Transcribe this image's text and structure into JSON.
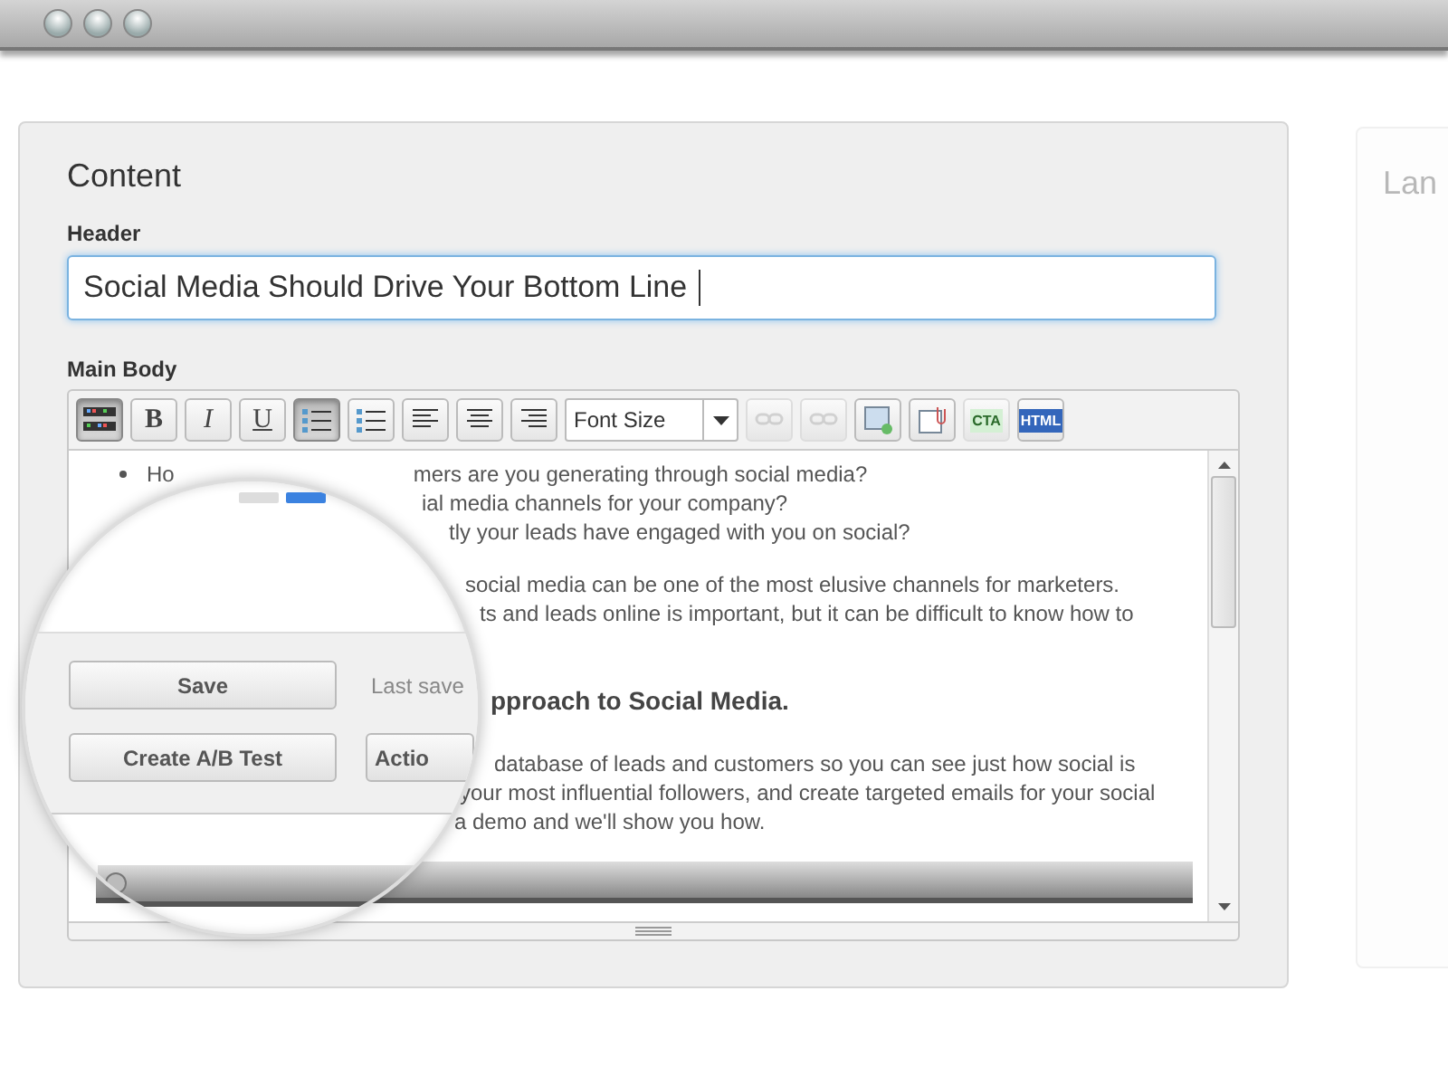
{
  "content_panel": {
    "title": "Content",
    "header_label": "Header",
    "header_value": "Social Media Should Drive Your Bottom Line",
    "body_label": "Main Body"
  },
  "toolbar": [
    {
      "kind": "colors",
      "selected": true,
      "disabled": false
    },
    {
      "kind": "bold",
      "label": "B",
      "selected": false,
      "disabled": false
    },
    {
      "kind": "italic",
      "label": "I",
      "selected": false,
      "disabled": false
    },
    {
      "kind": "underline",
      "label": "U",
      "selected": false,
      "disabled": false
    },
    {
      "kind": "bullets",
      "selected": true,
      "disabled": false
    },
    {
      "kind": "numbers",
      "selected": false,
      "disabled": false
    },
    {
      "kind": "align-left",
      "selected": false,
      "disabled": false
    },
    {
      "kind": "align-center",
      "selected": false,
      "disabled": false
    },
    {
      "kind": "align-right",
      "selected": false,
      "disabled": false
    },
    {
      "kind": "select",
      "label": "Font Size"
    },
    {
      "kind": "link",
      "selected": false,
      "disabled": true
    },
    {
      "kind": "unlink",
      "selected": false,
      "disabled": true
    },
    {
      "kind": "image",
      "selected": false,
      "disabled": false
    },
    {
      "kind": "attach",
      "selected": false,
      "disabled": false
    },
    {
      "kind": "cta",
      "label": "CTA",
      "selected": false,
      "disabled": true
    },
    {
      "kind": "html",
      "label": "HTML",
      "selected": false,
      "disabled": false
    }
  ],
  "editor_lines": [
    {
      "kind": "bullet",
      "space_before": false,
      "lead": "Ho",
      "text": "mers are you generating through social media?"
    },
    {
      "kind": "line",
      "space_before": false,
      "text": "ial media channels for your company?"
    },
    {
      "kind": "line",
      "space_before": false,
      "text": "tly your leads have engaged with you on social?"
    },
    {
      "kind": "line",
      "space_before": true,
      "text": "social media can be one of the most elusive channels for marketers."
    },
    {
      "kind": "line",
      "space_before": false,
      "text": "ts and leads online is important, but it can be difficult to know how to"
    },
    {
      "kind": "heading",
      "space_before": true,
      "text": "pproach to Social Media."
    },
    {
      "kind": "line",
      "space_before": true,
      "text": "database of leads and customers so you can see just how social is"
    },
    {
      "kind": "line",
      "space_before": false,
      "text": "your most influential followers, and create targeted emails for your social"
    },
    {
      "kind": "line",
      "space_before": false,
      "text": "a demo and we'll show you how."
    }
  ],
  "magnifier": {
    "save_button": "Save",
    "last_saved": "Last save",
    "ab_button": "Create A/B Test",
    "actions_button": "Actio"
  },
  "background_panel": {
    "title": "Lan"
  }
}
